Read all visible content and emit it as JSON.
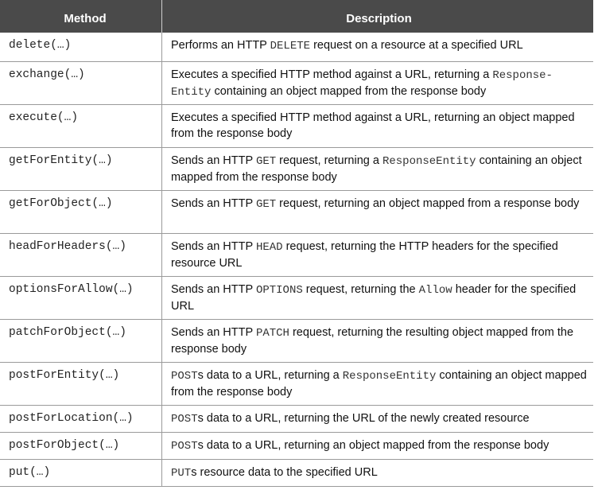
{
  "header": {
    "method": "Method",
    "description": "Description"
  },
  "rows": [
    {
      "method": "delete(…)",
      "desc": [
        [
          "t",
          "Performs an HTTP "
        ],
        [
          "c",
          "DELETE"
        ],
        [
          "t",
          " request on a resource at a specified URL"
        ]
      ]
    },
    {
      "method": "exchange(…)",
      "desc": [
        [
          "t",
          "Executes a specified HTTP method against a URL, returning a "
        ],
        [
          "c",
          "Response-Entity"
        ],
        [
          "t",
          " containing an object mapped from the response body"
        ]
      ]
    },
    {
      "method": "execute(…)",
      "desc": [
        [
          "t",
          "Executes a specified HTTP method against a URL, returning an object mapped from the response body"
        ]
      ]
    },
    {
      "method": "getForEntity(…)",
      "desc": [
        [
          "t",
          "Sends an HTTP "
        ],
        [
          "c",
          "GET"
        ],
        [
          "t",
          " request, returning a "
        ],
        [
          "c",
          "ResponseEntity"
        ],
        [
          "t",
          " containing an object mapped from the response body"
        ]
      ]
    },
    {
      "method": "getForObject(…)",
      "desc": [
        [
          "t",
          "Sends an HTTP "
        ],
        [
          "c",
          "GET"
        ],
        [
          "t",
          " request, returning an object mapped from a response body"
        ]
      ]
    },
    {
      "method": "headForHeaders(…)",
      "desc": [
        [
          "t",
          "Sends an HTTP "
        ],
        [
          "c",
          "HEAD"
        ],
        [
          "t",
          " request, returning the HTTP headers for the specified resource URL"
        ]
      ]
    },
    {
      "method": "optionsForAllow(…)",
      "desc": [
        [
          "t",
          "Sends an HTTP "
        ],
        [
          "c",
          "OPTIONS"
        ],
        [
          "t",
          " request, returning the "
        ],
        [
          "c",
          "Allow"
        ],
        [
          "t",
          " header for the specified URL"
        ]
      ]
    },
    {
      "method": "patchForObject(…)",
      "desc": [
        [
          "t",
          "Sends an HTTP "
        ],
        [
          "c",
          "PATCH"
        ],
        [
          "t",
          " request, returning the resulting object mapped from the response body"
        ]
      ]
    },
    {
      "method": "postForEntity(…)",
      "desc": [
        [
          "c",
          "POST"
        ],
        [
          "t",
          "s data to a URL, returning a "
        ],
        [
          "c",
          "ResponseEntity"
        ],
        [
          "t",
          " containing an object mapped from the response body"
        ]
      ]
    },
    {
      "method": "postForLocation(…)",
      "desc": [
        [
          "c",
          "POST"
        ],
        [
          "t",
          "s data to a URL, returning the URL of the newly created resource"
        ]
      ]
    },
    {
      "method": "postForObject(…)",
      "desc": [
        [
          "c",
          "POST"
        ],
        [
          "t",
          "s data to a URL, returning an object mapped from the response body"
        ]
      ]
    },
    {
      "method": "put(…)",
      "desc": [
        [
          "c",
          "PUT"
        ],
        [
          "t",
          "s resource data to the specified URL"
        ]
      ]
    }
  ]
}
